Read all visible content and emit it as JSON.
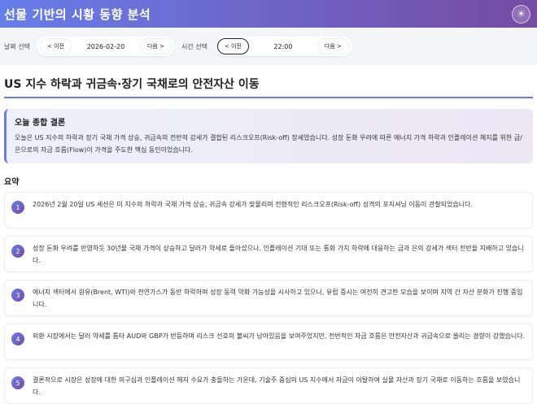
{
  "header": {
    "title": "선물 기반의 시황 동향 분석",
    "theme_icon": "☀"
  },
  "controls": {
    "date": {
      "label": "날짜 선택",
      "prev": "< 이전",
      "value": "2026-02-20",
      "next": "다음 >"
    },
    "time": {
      "label": "시간 선택",
      "prev": "< 이전",
      "value": "22:00",
      "next": "다음 >"
    }
  },
  "main": {
    "title": "US 지수 하락과 귀금속·장기 국채로의 안전자산 이동",
    "conclusion": {
      "heading": "오늘 종합 결론",
      "text": "오늘은 US 지수의 하락과 장기 국채 가격 상승, 귀금속의 전반적 강세가 결합된 리스크오프(Risk-off) 장세였습니다. 성장 둔화 우려에 따른 에너지 가격 하락과 인플레이션 헤지를 위한 금/은으로의 자금 흐름(Flow)이 가격을 주도한 핵심 동인이었습니다."
    },
    "summary_heading": "요약",
    "summary": [
      {
        "num": "1",
        "text": "2026년 2월 20일 US 세션은 미 지수의 하락과 국채 가격 상승, 귀금속 강세가 맞물리며 전형적인 리스크오프(Risk-off) 성격의 포지셔닝 이동이 관찰되었습니다."
      },
      {
        "num": "2",
        "text": "성장 둔화 우려를 반영하듯 30년물 국채 가격이 상승하고 달러가 약세로 돌아섰으나, 인플레이션 기대 또는 통화 가치 하락에 대응하는 금과 은의 강세가 섹터 전반을 지배하고 있습니다."
      },
      {
        "num": "3",
        "text": "에너지 섹터에서 원유(Brent, WTI)와 천연가스가 동반 하락하며 성장 동력 약화 가능성을 시사하고 있으나, 유럽 증시는 여전히 견고한 모습을 보이며 지역 간 자산 분화가 진행 중입니다."
      },
      {
        "num": "4",
        "text": "외환 시장에서는 달러 약세를 틈타 AUD와 GBP가 반등하며 리스크 선호의 불씨가 남아있음을 보여주었지만, 전반적인 자금 흐름은 안전자산과 귀금속으로 쏠리는 경향이 강했습니다."
      },
      {
        "num": "5",
        "text": "결론적으로 시장은 성장에 대한 의구심과 인플레이션 헤지 수요가 충돌하는 가운데, 기술주 중심의 US 지수에서 자금이 이탈하여 실물 자산과 장기 국채로 이동하는 흐름을 보였습니다."
      }
    ]
  }
}
